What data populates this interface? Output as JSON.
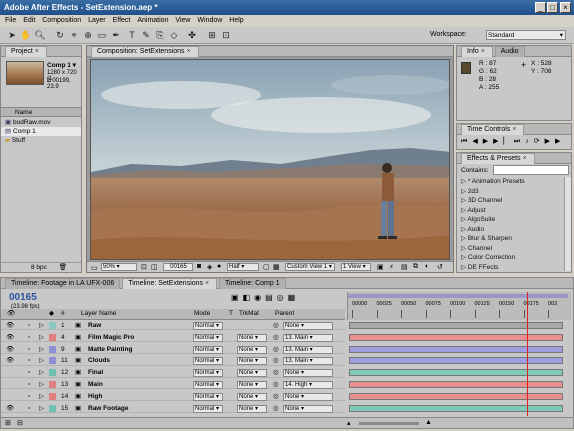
{
  "window": {
    "title": "Adobe After Effects - SetExtension.aep *"
  },
  "menu": [
    "File",
    "Edit",
    "Composition",
    "Layer",
    "Effect",
    "Animation",
    "View",
    "Window",
    "Help"
  ],
  "toolbar": {
    "workspace_label": "Workspace:",
    "workspace_value": "Standard"
  },
  "project": {
    "tab": "Project",
    "selected_name": "Comp 1 ▾",
    "selected_dims": "1280 x 720 (1",
    "selected_dur": "Δ 00199, 23.9",
    "column_name": "Name",
    "items": [
      {
        "label": "budRaw.mov",
        "kind": "footage"
      },
      {
        "label": "Comp 1",
        "kind": "comp"
      },
      {
        "label": "Stuff",
        "kind": "folder"
      }
    ],
    "bpc": "8 bpc"
  },
  "composition": {
    "tab": "Composition: SetExtensions",
    "zoom": "50%",
    "timecode": "00165",
    "resolution": "Half",
    "view": "Custom View 1",
    "views": "1 View"
  },
  "info": {
    "tabs": [
      "Info",
      "Audio"
    ],
    "r": "R : 87",
    "g": "G : 62",
    "b": "B : 28",
    "a": "A : 255",
    "x": "X : 528",
    "y": "Y : 708",
    "swatch": "#574a2c"
  },
  "time_controls": {
    "tab": "Time Controls"
  },
  "effects": {
    "tab": "Effects & Presets",
    "contains_label": "Contains:",
    "items": [
      "* Animation Presets",
      "2d3",
      "3D Channel",
      "Adjust",
      "AlgoSuite",
      "Audio",
      "Blur & Sharpen",
      "Channel",
      "Color Correction",
      "DE FFects"
    ]
  },
  "timeline": {
    "tabs": [
      "Timeline: Footage in LA UFX-006",
      "Timeline: SetExtensions",
      "Timeline: Comp 1"
    ],
    "timecode": "00165",
    "fps": "(23.98 fps)",
    "columns": {
      "num": "#",
      "layer_name": "Layer Name",
      "mode": "Mode",
      "t": "T",
      "trkmat": "TrkMat",
      "parent": "Parent"
    },
    "ruler": [
      "00000",
      "00025",
      "00050",
      "00075",
      "00100",
      "00125",
      "00150",
      "00175",
      "002"
    ],
    "playhead_fraction": 0.82,
    "layers": [
      {
        "num": "1",
        "name": "Raw",
        "mode": "Normal",
        "trkmat": "",
        "parent": "None",
        "color": "#8ac8c0",
        "bar": "#a8a8a8",
        "eye": true
      },
      {
        "num": "4",
        "name": "Film Magic Pro",
        "mode": "Normal",
        "trkmat": "None",
        "parent": "13. Main",
        "color": "#e08080",
        "bar": "#e89090",
        "eye": true
      },
      {
        "num": "9",
        "name": "Matte Painting",
        "mode": "Normal",
        "trkmat": "None",
        "parent": "13. Main",
        "color": "#9090d8",
        "bar": "#9e9ee0",
        "eye": true
      },
      {
        "num": "11",
        "name": "Clouds",
        "mode": "Normal",
        "trkmat": "None",
        "parent": "13. Main",
        "color": "#9090d8",
        "bar": "#9e9ee0",
        "eye": true
      },
      {
        "num": "12",
        "name": "Final",
        "mode": "Normal",
        "trkmat": "None",
        "parent": "None",
        "color": "#70c0b0",
        "bar": "#80c8b8",
        "eye": false
      },
      {
        "num": "13",
        "name": "Main",
        "mode": "Normal",
        "trkmat": "None",
        "parent": "14. High",
        "color": "#e08080",
        "bar": "#e89090",
        "eye": false
      },
      {
        "num": "14",
        "name": "High",
        "mode": "Normal",
        "trkmat": "None",
        "parent": "None",
        "color": "#e08080",
        "bar": "#e89090",
        "eye": false
      },
      {
        "num": "15",
        "name": "Raw Footage",
        "mode": "Normal",
        "trkmat": "None",
        "parent": "None",
        "color": "#70c0b0",
        "bar": "#80c8b8",
        "eye": true
      }
    ]
  }
}
